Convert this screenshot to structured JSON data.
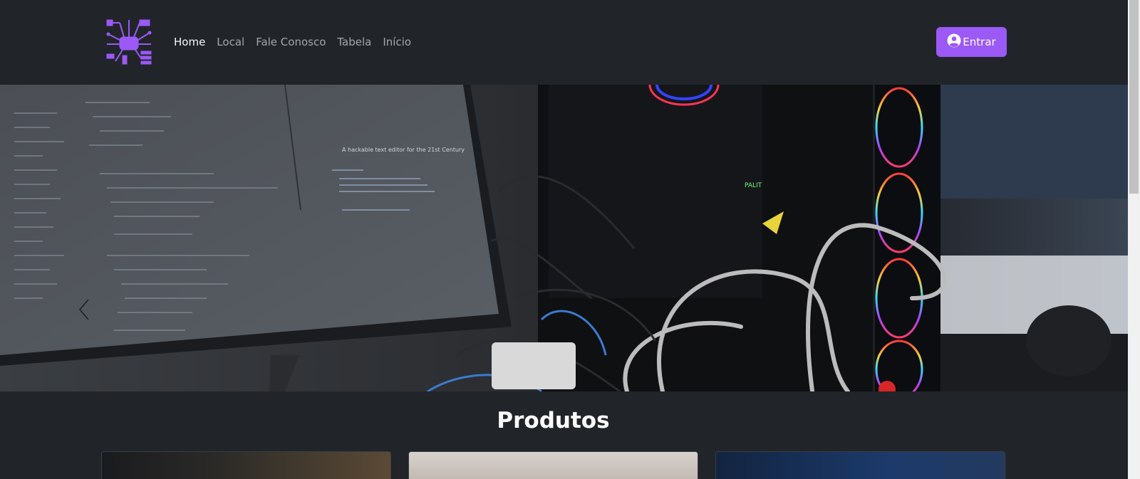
{
  "navbar": {
    "logo_icon": "circuit-chip-logo-icon",
    "links": [
      {
        "label": "Home",
        "active": true
      },
      {
        "label": "Local",
        "active": false
      },
      {
        "label": "Fale Conosco",
        "active": false
      },
      {
        "label": "Tabela",
        "active": false
      },
      {
        "label": "Início",
        "active": false
      }
    ],
    "login_label": "Entrar",
    "login_icon": "user-circle-icon"
  },
  "carousel": {
    "prev_icon": "chevron-left-icon",
    "monitor_heading": "A hackable text editor for the 21st Century"
  },
  "products": {
    "title": "Produtos"
  },
  "colors": {
    "background": "#212529",
    "accent": "#9b59f6"
  }
}
